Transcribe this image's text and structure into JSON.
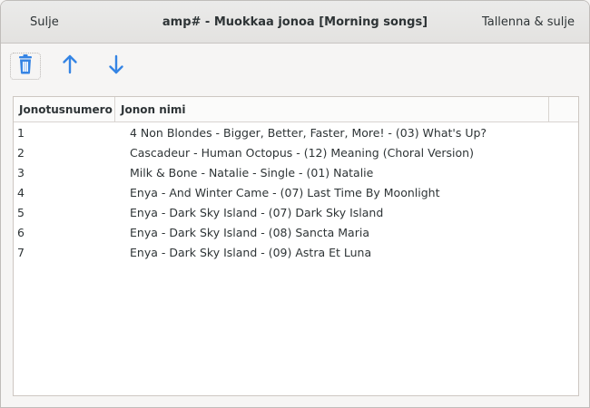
{
  "header": {
    "close_label": "Sulje",
    "title": "amp# - Muokkaa jonoa [Morning songs]",
    "save_close_label": "Tallenna & sulje"
  },
  "toolbar": {
    "delete_icon": "trash-icon",
    "up_icon": "arrow-up-icon",
    "down_icon": "arrow-down-icon",
    "accent_color": "#3584e4"
  },
  "table": {
    "columns": [
      "Jonotusnumero",
      "Jonon nimi",
      ""
    ],
    "rows": [
      {
        "num": "1",
        "name": "4 Non Blondes - Bigger, Better, Faster, More! - (03) What's Up?"
      },
      {
        "num": "2",
        "name": "Cascadeur - Human Octopus - (12) Meaning (Choral Version)"
      },
      {
        "num": "3",
        "name": "Milk & Bone - Natalie - Single - (01) Natalie"
      },
      {
        "num": "4",
        "name": "Enya - And Winter Came - (07) Last Time By Moonlight"
      },
      {
        "num": "5",
        "name": "Enya - Dark Sky Island - (07) Dark Sky Island"
      },
      {
        "num": "6",
        "name": "Enya - Dark Sky Island - (08) Sancta Maria"
      },
      {
        "num": "7",
        "name": "Enya - Dark Sky Island - (09) Astra Et Luna"
      }
    ]
  }
}
